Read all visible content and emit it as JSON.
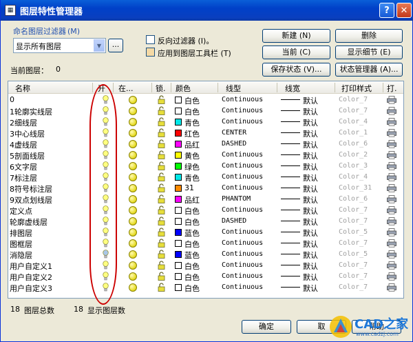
{
  "window": {
    "title": "图层特性管理器",
    "help_label": "?",
    "close_label": "✕"
  },
  "filter": {
    "label": "命名图层过滤器",
    "shortcut": "(M)",
    "selected": "显示所有图层",
    "browse_label": "...",
    "invert_label": "反向过滤器 (I)。",
    "apply_toolbar_label": "应用到图层工具栏 (T)"
  },
  "current_layer": {
    "label": "当前图层：",
    "value": "0"
  },
  "buttons": {
    "new": "新建 (N)",
    "delete": "删除",
    "current": "当前 (C)",
    "show_details": "显示细节 (E)",
    "save_state": "保存状态 (V)...",
    "state_manager": "状态管理器 (A)...",
    "ok": "确定",
    "cancel": "取",
    "help": "帮助"
  },
  "columns": [
    "名称",
    "开",
    "在...",
    "锁.",
    "颜色",
    "线型",
    "线宽",
    "打印样式",
    "打."
  ],
  "colors": {
    "white": "#ffffff",
    "cyan": "#00e8e8",
    "red": "#ff0000",
    "magenta": "#ff00ff",
    "yellow": "#ffff00",
    "green": "#00ff00",
    "orange": "#ff8a00",
    "blue": "#0000ff",
    "oval": "#cc0000"
  },
  "layers": [
    {
      "name": "0",
      "color_name": "白色",
      "color": "#ffffff",
      "linetype": "Continuous",
      "lineweight": "默认",
      "plot_style": "Color_7",
      "on": true
    },
    {
      "name": "1轮廓实线层",
      "color_name": "白色",
      "color": "#ffffff",
      "linetype": "Continuous",
      "lineweight": "默认",
      "plot_style": "Color_7",
      "on": true
    },
    {
      "name": "2细线层",
      "color_name": "青色",
      "color": "#00e8e8",
      "linetype": "Continuous",
      "lineweight": "默认",
      "plot_style": "Color_4",
      "on": true
    },
    {
      "name": "3中心线层",
      "color_name": "红色",
      "color": "#ff0000",
      "linetype": "CENTER",
      "lineweight": "默认",
      "plot_style": "Color_1",
      "on": true
    },
    {
      "name": "4虚线层",
      "color_name": "品红",
      "color": "#ff00ff",
      "linetype": "DASHED",
      "lineweight": "默认",
      "plot_style": "Color_6",
      "on": true
    },
    {
      "name": "5剖面线层",
      "color_name": "黄色",
      "color": "#ffff00",
      "linetype": "Continuous",
      "lineweight": "默认",
      "plot_style": "Color_2",
      "on": true
    },
    {
      "name": "6文字层",
      "color_name": "绿色",
      "color": "#00ff00",
      "linetype": "Continuous",
      "lineweight": "默认",
      "plot_style": "Color_3",
      "on": true
    },
    {
      "name": "7标注层",
      "color_name": "青色",
      "color": "#00e8e8",
      "linetype": "Continuous",
      "lineweight": "默认",
      "plot_style": "Color_4",
      "on": true
    },
    {
      "name": "8符号标注层",
      "color_name": "31",
      "color": "#ff8a00",
      "linetype": "Continuous",
      "lineweight": "默认",
      "plot_style": "Color_31",
      "on": true
    },
    {
      "name": "9双点划线层",
      "color_name": "品红",
      "color": "#ff00ff",
      "linetype": "PHANTOM",
      "lineweight": "默认",
      "plot_style": "Color_6",
      "on": true
    },
    {
      "name": "定义点",
      "color_name": "白色",
      "color": "#ffffff",
      "linetype": "Continuous",
      "lineweight": "默认",
      "plot_style": "Color_7",
      "on": true
    },
    {
      "name": "轮廓虚线层",
      "color_name": "白色",
      "color": "#ffffff",
      "linetype": "DASHED",
      "lineweight": "默认",
      "plot_style": "Color_7",
      "on": true
    },
    {
      "name": "排图层",
      "color_name": "蓝色",
      "color": "#0000ff",
      "linetype": "Continuous",
      "lineweight": "默认",
      "plot_style": "Color_5",
      "on": true
    },
    {
      "name": "图框层",
      "color_name": "白色",
      "color": "#ffffff",
      "linetype": "Continuous",
      "lineweight": "默认",
      "plot_style": "Color_7",
      "on": true
    },
    {
      "name": "消隐层",
      "color_name": "蓝色",
      "color": "#0000ff",
      "linetype": "Continuous",
      "lineweight": "默认",
      "plot_style": "Color_5",
      "on": false
    },
    {
      "name": "用户自定义1",
      "color_name": "白色",
      "color": "#ffffff",
      "linetype": "Continuous",
      "lineweight": "默认",
      "plot_style": "Color_7",
      "on": true
    },
    {
      "name": "用户自定义2",
      "color_name": "白色",
      "color": "#ffffff",
      "linetype": "Continuous",
      "lineweight": "默认",
      "plot_style": "Color_7",
      "on": true
    },
    {
      "name": "用户自定义3",
      "color_name": "白色",
      "color": "#ffffff",
      "linetype": "Continuous",
      "lineweight": "默认",
      "plot_style": "Color_7",
      "on": true
    }
  ],
  "status": {
    "total_count": "18",
    "total_label": "图层总数",
    "shown_count": "18",
    "shown_label": "显示图层数"
  },
  "watermark": {
    "text": "CAD之家",
    "url_text": "www.cadzj.com"
  }
}
